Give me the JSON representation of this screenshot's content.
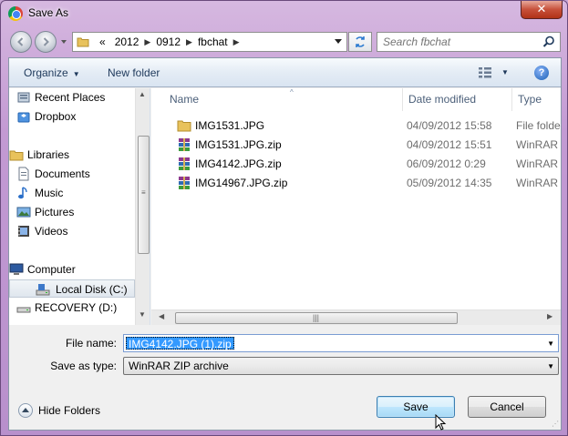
{
  "window": {
    "title": "Save As",
    "close_label": "✕"
  },
  "address": {
    "overflow": "«",
    "crumbs": [
      "2012",
      "0912",
      "fbchat"
    ],
    "search_placeholder": "Search fbchat"
  },
  "toolbar": {
    "organize_label": "Organize",
    "new_folder_label": "New folder",
    "help_label": "?"
  },
  "nav": {
    "items": [
      {
        "label": "Recent Places",
        "icon": "recent-places-icon"
      },
      {
        "label": "Dropbox",
        "icon": "dropbox-icon"
      },
      {
        "label": "Libraries",
        "icon": "libraries-icon"
      },
      {
        "label": "Documents",
        "icon": "documents-icon"
      },
      {
        "label": "Music",
        "icon": "music-icon"
      },
      {
        "label": "Pictures",
        "icon": "pictures-icon"
      },
      {
        "label": "Videos",
        "icon": "videos-icon"
      },
      {
        "label": "Computer",
        "icon": "computer-icon"
      },
      {
        "label": "Local Disk (C:)",
        "icon": "local-disk-icon"
      },
      {
        "label": "RECOVERY (D:)",
        "icon": "drive-icon"
      }
    ]
  },
  "files": {
    "columns": {
      "name": "Name",
      "date": "Date modified",
      "type": "Type"
    },
    "rows": [
      {
        "name": "IMG1531.JPG",
        "date": "04/09/2012 15:58",
        "type": "File folder",
        "icon": "folder-icon"
      },
      {
        "name": "IMG1531.JPG.zip",
        "date": "04/09/2012 15:51",
        "type": "WinRAR ZIP archive",
        "icon": "winrar-icon"
      },
      {
        "name": "IMG4142.JPG.zip",
        "date": "06/09/2012 0:29",
        "type": "WinRAR ZIP archive",
        "icon": "winrar-icon"
      },
      {
        "name": "IMG14967.JPG.zip",
        "date": "05/09/2012 14:35",
        "type": "WinRAR ZIP archive",
        "icon": "winrar-icon"
      }
    ]
  },
  "form": {
    "file_name_label": "File name:",
    "file_name_value": "IMG4142.JPG (1).zip",
    "save_type_label": "Save as type:",
    "save_type_value": "WinRAR ZIP archive"
  },
  "footer": {
    "hide_folders_label": "Hide Folders",
    "save_label": "Save",
    "cancel_label": "Cancel"
  }
}
